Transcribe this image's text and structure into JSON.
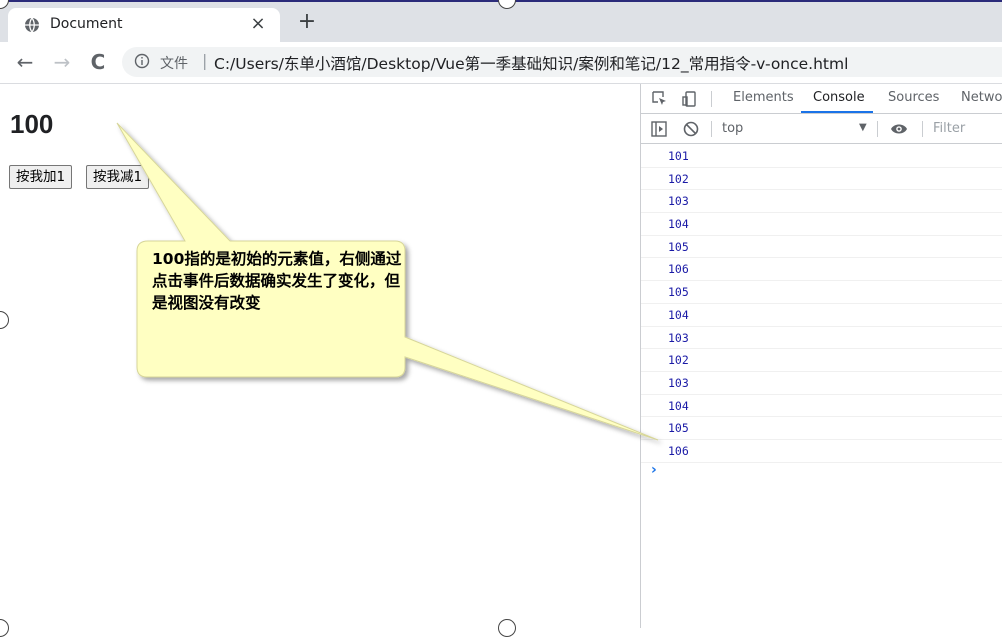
{
  "browser": {
    "tab_title": "Document",
    "close_glyph": "×",
    "newtab_glyph": "+",
    "nav": {
      "back": "←",
      "forward": "→",
      "reload": "C"
    },
    "scheme_label": "文件",
    "separator": "|",
    "url": "C:/Users/东单小酒馆/Desktop/Vue第一季基础知识/案例和笔记/12_常用指令-v-once.html"
  },
  "page": {
    "heading": "100",
    "buttons": [
      "按我加1",
      "按我减1"
    ]
  },
  "callout": {
    "text": "100指的是初始的元素值，右侧通过点击事件后数据确实发生了变化，但是视图没有改变",
    "fill": "#ffffc2"
  },
  "devtools": {
    "tabs": [
      "Elements",
      "Console",
      "Sources",
      "Netwo"
    ],
    "active_tab": "Console",
    "context": "top",
    "context_arrow": "▼",
    "filter_placeholder": "Filter",
    "prompt": "›",
    "logs": [
      "101",
      "102",
      "103",
      "104",
      "105",
      "106",
      "105",
      "104",
      "103",
      "102",
      "103",
      "104",
      "105",
      "106"
    ]
  },
  "colors": {
    "accent": "#1a73e8",
    "log_text": "#1a1aa6",
    "tabstrip": "#dee1e6"
  }
}
